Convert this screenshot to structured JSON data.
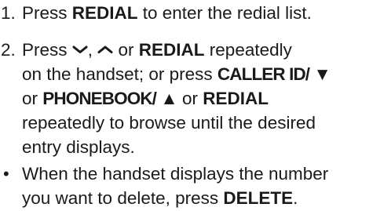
{
  "steps": [
    {
      "number": "1.",
      "text_1": "Press ",
      "key_1": "REDIAL",
      "text_2": " to enter the redial list."
    },
    {
      "number": "2.",
      "text_1": "Press ",
      "icon_down": "chevron-down-icon",
      "sep_1": ", ",
      "icon_up": "chevron-up-icon",
      "sep_2": " or ",
      "key_1": "REDIAL",
      "text_2": " repeatedly",
      "text_3": "on the handset; or press ",
      "key_2": "CALLER ID/ ▼",
      "text_4": "or ",
      "key_3": "PHONEBOOK/ ▲",
      "text_5": " or ",
      "key_4": "REDIAL",
      "text_6": "repeatedly to browse until the desired",
      "text_7": "entry displays."
    }
  ],
  "bullet": {
    "marker": "•",
    "text_1": "When the handset displays the number",
    "text_2": "you want to delete, press ",
    "key_1": "DELETE",
    "text_3": "."
  }
}
